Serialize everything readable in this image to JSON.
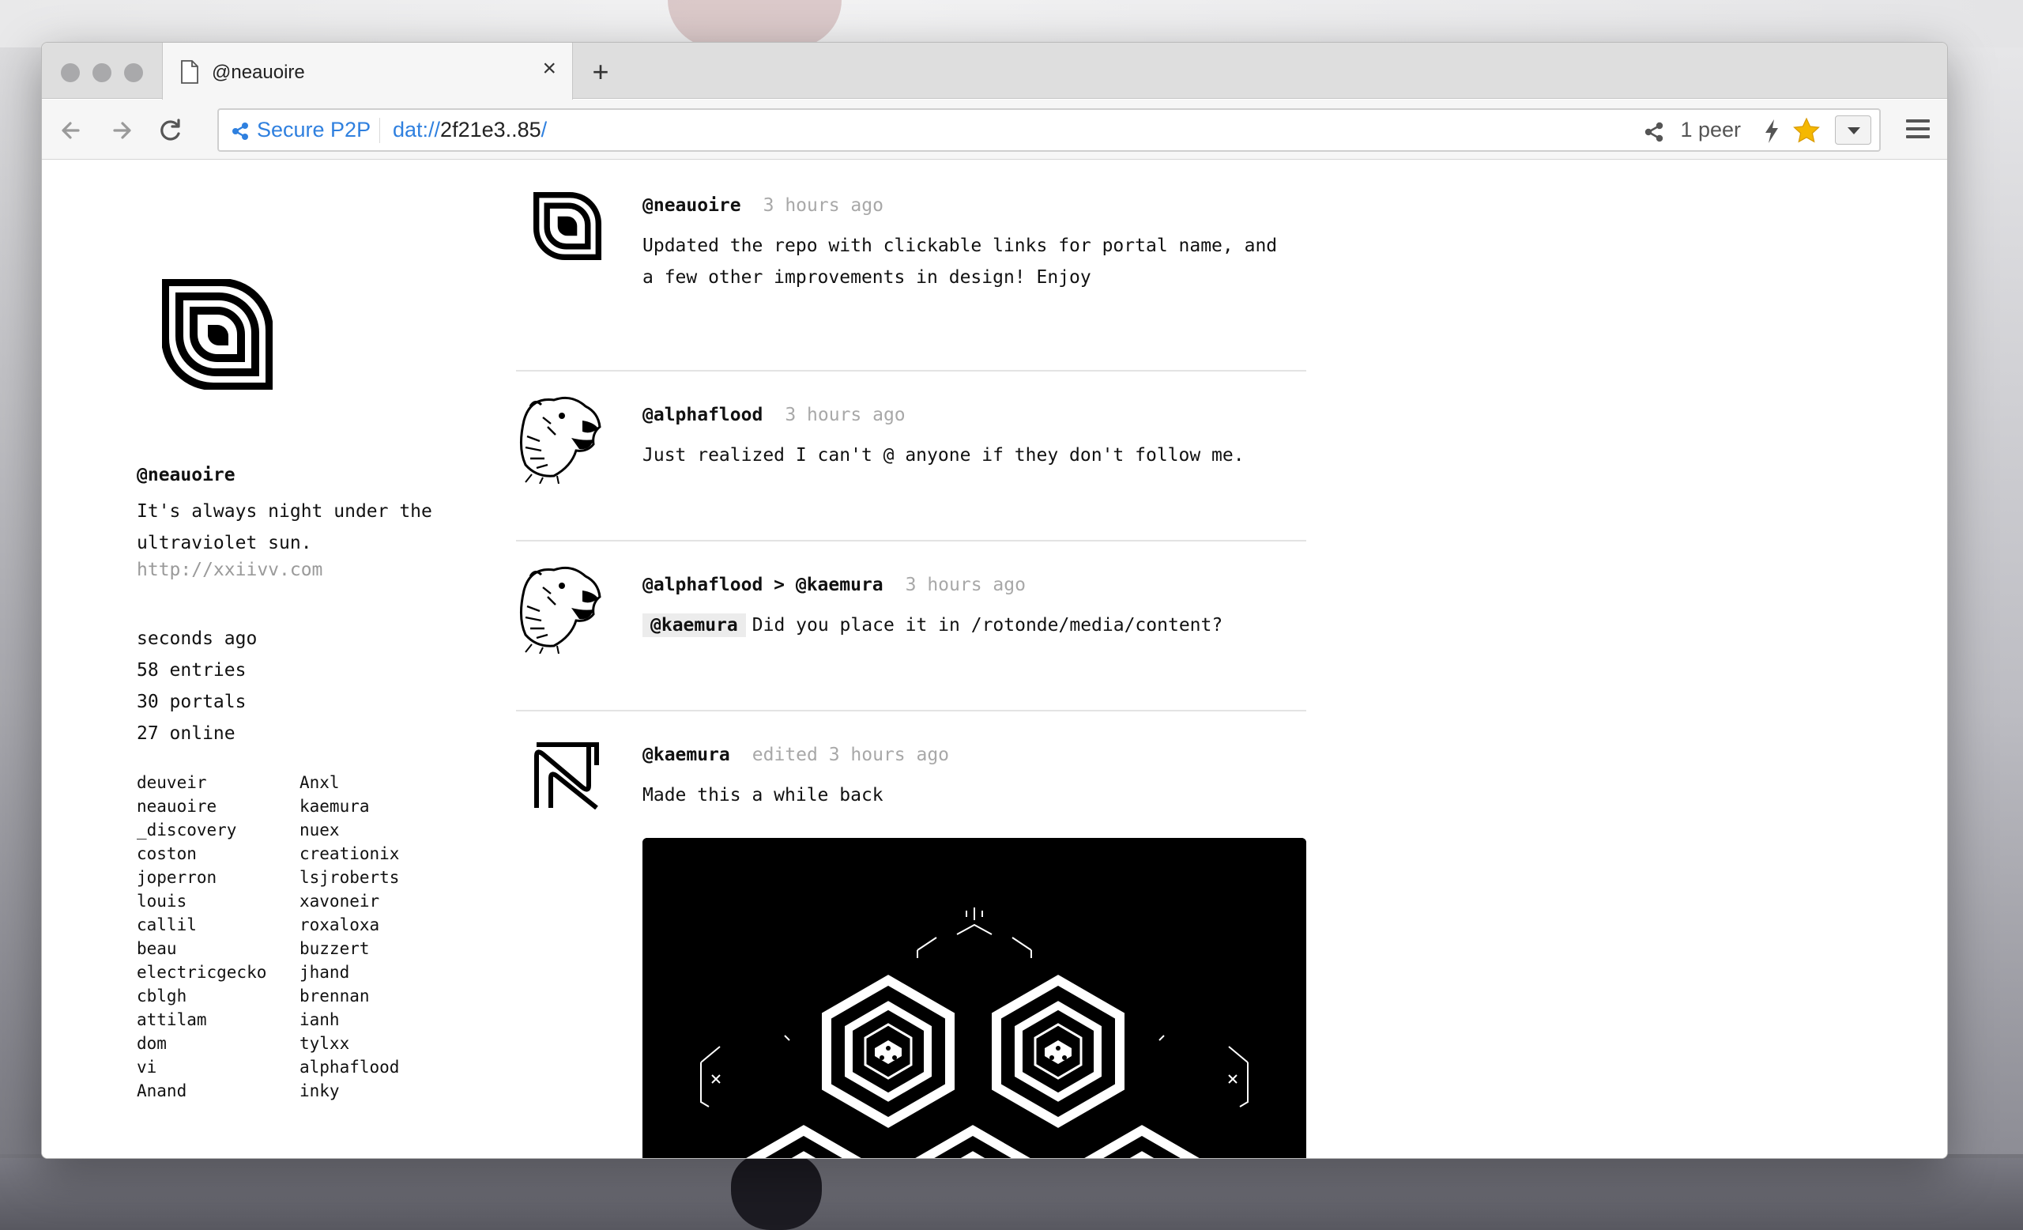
{
  "browser": {
    "tab_title": "@neauoire",
    "tab_close": "×",
    "new_tab": "+",
    "secure_label": "Secure P2P",
    "url_scheme": "dat://",
    "url_host": "2f21e3..85",
    "url_suffix": "/",
    "peers": "1 peer",
    "icons": {
      "back": "back-arrow-icon",
      "forward": "forward-arrow-icon",
      "reload": "reload-icon",
      "share": "share-icon",
      "bolt": "lightning-icon",
      "star": "star-icon",
      "menu": "hamburger-menu-icon"
    },
    "colors": {
      "accent": "#2f80df",
      "star": "#f5b800"
    }
  },
  "profile": {
    "name": "@neauoire",
    "bio": "It's always night under the ultraviolet sun.",
    "link": "http://xxiivv.com",
    "stats": [
      "seconds ago",
      "58 entries",
      "30 portals",
      "27 online"
    ],
    "portals_left": [
      "deuveir",
      "neauoire",
      "_discovery",
      "coston",
      "joperron",
      "louis",
      "callil",
      "beau",
      "electricgecko",
      "cblgh",
      "attilam",
      "dom",
      "vi",
      "Anand"
    ],
    "portals_right": [
      "Anxl",
      "kaemura",
      "nuex",
      "creationix",
      "lsjroberts",
      "xavoneir",
      "roxaloxa",
      "buzzert",
      "jhand",
      "brennan",
      "ianh",
      "tylxx",
      "alphaflood",
      "inky"
    ]
  },
  "feed": [
    {
      "author": "@neauoire",
      "time": "3 hours ago",
      "body": "Updated the repo with clickable links for portal name, and a few other improvements in design! Enjoy",
      "avatar": "spiral-logo"
    },
    {
      "author": "@alphaflood",
      "time": "3 hours ago",
      "body": "Just realized I can't @ anyone if they don't follow me.",
      "avatar": "bear-sketch"
    },
    {
      "author": "@alphaflood > @kaemura",
      "time": "3 hours ago",
      "mention": "@kaemura",
      "body": "Did you place it in /rotonde/media/content?",
      "avatar": "bear-sketch"
    },
    {
      "author": "@kaemura",
      "time": "edited 3 hours ago",
      "body": "Made this a while back",
      "avatar": "zigzag-logo",
      "media": "hexagon-artwork"
    }
  ]
}
